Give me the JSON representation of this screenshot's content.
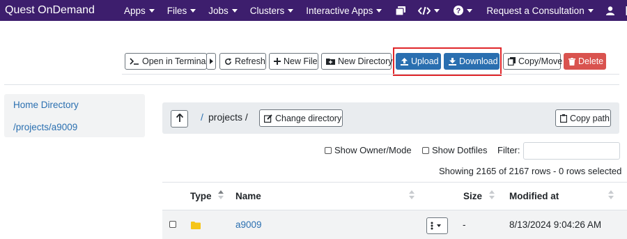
{
  "navbar": {
    "brand": "Quest OnDemand",
    "items": [
      {
        "label": "Apps"
      },
      {
        "label": "Files"
      },
      {
        "label": "Jobs"
      },
      {
        "label": "Clusters"
      },
      {
        "label": "Interactive Apps"
      }
    ],
    "consultation": "Request a Consultation",
    "bg_color": "#3d1e6d"
  },
  "toolbar": {
    "open_terminal": "Open in Terminal",
    "refresh": "Refresh",
    "new_file": "New File",
    "new_directory": "New Directory",
    "upload": "Upload",
    "download": "Download",
    "copy_move": "Copy/Move",
    "delete": "Delete"
  },
  "sidebar": {
    "items": [
      {
        "label": "Home Directory"
      },
      {
        "label": "/projects/a9009"
      }
    ]
  },
  "pathbar": {
    "separator": "/",
    "segment": "projects /",
    "change_directory": "Change directory",
    "copy_path": "Copy path"
  },
  "filters": {
    "show_owner_mode": "Show Owner/Mode",
    "show_dotfiles": "Show Dotfiles",
    "filter_label": "Filter:",
    "filter_value": ""
  },
  "status": "Showing 2165 of 2167 rows - 0 rows selected",
  "table": {
    "columns": [
      "Type",
      "Name",
      "Size",
      "Modified at"
    ],
    "rows": [
      {
        "type": "folder-icon",
        "name": "a9009",
        "size": "-",
        "modified": "8/13/2024 9:04:26 AM"
      }
    ]
  },
  "colors": {
    "primary": "#2a6fb0",
    "danger": "#d9534f",
    "highlight": "#e0262a",
    "folder": "#f5c518"
  }
}
